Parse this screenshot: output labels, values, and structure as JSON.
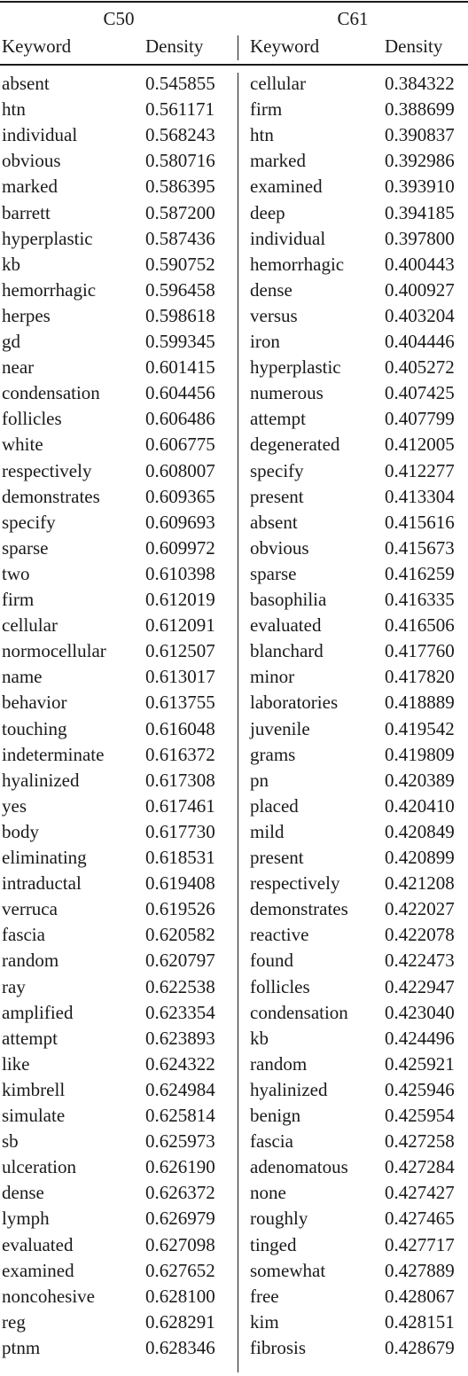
{
  "table": {
    "groups": [
      "C50",
      "C61"
    ],
    "headers": [
      "Keyword",
      "Density",
      "Keyword",
      "Density"
    ],
    "rows": [
      [
        "absent",
        "0.545855",
        "cellular",
        "0.384322"
      ],
      [
        "htn",
        "0.561171",
        "firm",
        "0.388699"
      ],
      [
        "individual",
        "0.568243",
        "htn",
        "0.390837"
      ],
      [
        "obvious",
        "0.580716",
        "marked",
        "0.392986"
      ],
      [
        "marked",
        "0.586395",
        "examined",
        "0.393910"
      ],
      [
        "barrett",
        "0.587200",
        "deep",
        "0.394185"
      ],
      [
        "hyperplastic",
        "0.587436",
        "individual",
        "0.397800"
      ],
      [
        "kb",
        "0.590752",
        "hemorrhagic",
        "0.400443"
      ],
      [
        "hemorrhagic",
        "0.596458",
        "dense",
        "0.400927"
      ],
      [
        "herpes",
        "0.598618",
        "versus",
        "0.403204"
      ],
      [
        "gd",
        "0.599345",
        "iron",
        "0.404446"
      ],
      [
        "near",
        "0.601415",
        "hyperplastic",
        "0.405272"
      ],
      [
        "condensation",
        "0.604456",
        "numerous",
        "0.407425"
      ],
      [
        "follicles",
        "0.606486",
        "attempt",
        "0.407799"
      ],
      [
        "white",
        "0.606775",
        "degenerated",
        "0.412005"
      ],
      [
        "respectively",
        "0.608007",
        "specify",
        "0.412277"
      ],
      [
        "demonstrates",
        "0.609365",
        "present",
        "0.413304"
      ],
      [
        "specify",
        "0.609693",
        "absent",
        "0.415616"
      ],
      [
        "sparse",
        "0.609972",
        "obvious",
        "0.415673"
      ],
      [
        "two",
        "0.610398",
        "sparse",
        "0.416259"
      ],
      [
        "firm",
        "0.612019",
        "basophilia",
        "0.416335"
      ],
      [
        "cellular",
        "0.612091",
        "evaluated",
        "0.416506"
      ],
      [
        "normocellular",
        "0.612507",
        "blanchard",
        "0.417760"
      ],
      [
        "name",
        "0.613017",
        "minor",
        "0.417820"
      ],
      [
        "behavior",
        "0.613755",
        "laboratories",
        "0.418889"
      ],
      [
        "touching",
        "0.616048",
        "juvenile",
        "0.419542"
      ],
      [
        "indeterminate",
        "0.616372",
        "grams",
        "0.419809"
      ],
      [
        "hyalinized",
        "0.617308",
        "pn",
        "0.420389"
      ],
      [
        "yes",
        "0.617461",
        "placed",
        "0.420410"
      ],
      [
        "body",
        "0.617730",
        "mild",
        "0.420849"
      ],
      [
        "eliminating",
        "0.618531",
        "present",
        "0.420899"
      ],
      [
        "intraductal",
        "0.619408",
        "respectively",
        "0.421208"
      ],
      [
        "verruca",
        "0.619526",
        "demonstrates",
        "0.422027"
      ],
      [
        "fascia",
        "0.620582",
        "reactive",
        "0.422078"
      ],
      [
        "random",
        "0.620797",
        "found",
        "0.422473"
      ],
      [
        "ray",
        "0.622538",
        "follicles",
        "0.422947"
      ],
      [
        "amplified",
        "0.623354",
        "condensation",
        "0.423040"
      ],
      [
        "attempt",
        "0.623893",
        "kb",
        "0.424496"
      ],
      [
        "like",
        "0.624322",
        "random",
        "0.425921"
      ],
      [
        "kimbrell",
        "0.624984",
        "hyalinized",
        "0.425946"
      ],
      [
        "simulate",
        "0.625814",
        "benign",
        "0.425954"
      ],
      [
        "sb",
        "0.625973",
        "fascia",
        "0.427258"
      ],
      [
        "ulceration",
        "0.626190",
        "adenomatous",
        "0.427284"
      ],
      [
        "dense",
        "0.626372",
        "none",
        "0.427427"
      ],
      [
        "lymph",
        "0.626979",
        "roughly",
        "0.427465"
      ],
      [
        "evaluated",
        "0.627098",
        "tinged",
        "0.427717"
      ],
      [
        "examined",
        "0.627652",
        "somewhat",
        "0.427889"
      ],
      [
        "noncohesive",
        "0.628100",
        "free",
        "0.428067"
      ],
      [
        "reg",
        "0.628291",
        "kim",
        "0.428151"
      ],
      [
        "ptnm",
        "0.628346",
        "fibrosis",
        "0.428679"
      ]
    ]
  }
}
